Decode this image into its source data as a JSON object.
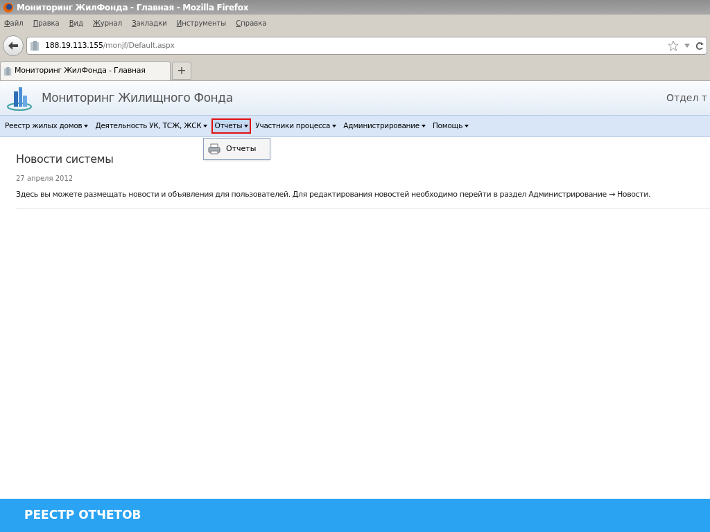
{
  "window": {
    "title": "Мониторинг ЖилФонда - Главная - Mozilla Firefox"
  },
  "menu_bar": [
    "Файл",
    "Правка",
    "Вид",
    "Журнал",
    "Закладки",
    "Инструменты",
    "Справка"
  ],
  "address_bar": {
    "host": "188.19.113.155",
    "path": "/monjf/Default.aspx"
  },
  "tabs": [
    {
      "label": "Мониторинг ЖилФонда - Главная",
      "selected": true
    }
  ],
  "new_tab": "+",
  "app_header": {
    "title": "Мониторинг Жилищного Фонда",
    "user": "Отдел т"
  },
  "nav": [
    {
      "label": "Реестр жилых домов",
      "selected": false
    },
    {
      "label": "Деятельность УК, ТСЖ, ЖСК",
      "selected": false
    },
    {
      "label": "Отчеты",
      "selected": true
    },
    {
      "label": "Участники процесса",
      "selected": false
    },
    {
      "label": "Администрирование",
      "selected": false
    },
    {
      "label": "Помощь",
      "selected": false
    }
  ],
  "dropdown": [
    {
      "label": "Отчеты"
    }
  ],
  "news": {
    "heading": "Новости системы",
    "date": "27 апреля 2012",
    "text": "Здесь вы можете размещать новости и объявления для пользователей. Для редактирования новостей необходимо перейти в раздел Администрирование → Новости."
  },
  "footer": {
    "caption": "РЕЕСТР ОТЧЕТОВ"
  }
}
